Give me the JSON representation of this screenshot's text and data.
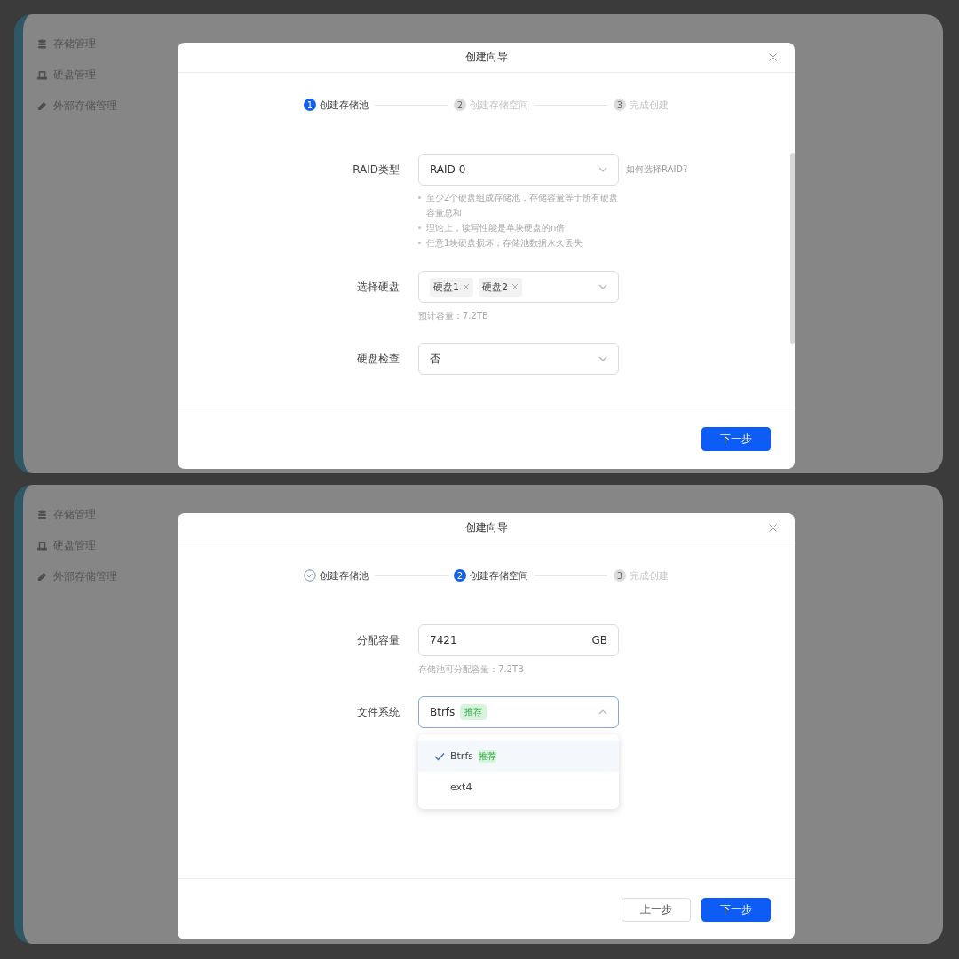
{
  "screens": [
    {
      "sidebar": {
        "items": [
          {
            "label": "存储管理"
          },
          {
            "label": "硬盘管理"
          },
          {
            "label": "外部存储管理"
          }
        ]
      },
      "dialog": {
        "title": "创建向导",
        "has_scrollbar": true,
        "steps": [
          {
            "kind": "current",
            "number": "1",
            "label": "创建存储池"
          },
          {
            "kind": "pending",
            "number": "2",
            "label": "创建存储空间"
          },
          {
            "kind": "pending",
            "number": "3",
            "label": "完成创建"
          }
        ],
        "fields": [
          {
            "kind": "select",
            "label": "RAID类型",
            "value": "RAID 0",
            "expanded": false,
            "link": "如何选择RAID?",
            "notes": [
              "至少2个硬盘组成存储池，存储容量等于所有硬盘容量总和",
              "理论上，读写性能是单块硬盘的n倍",
              "任意1块硬盘损坏，存储池数据永久丢失"
            ]
          },
          {
            "kind": "tags",
            "label": "选择硬盘",
            "tags": [
              "硬盘1",
              "硬盘2"
            ],
            "hint": "预计容量：7.2TB"
          },
          {
            "kind": "select",
            "label": "硬盘检查",
            "value": "否",
            "expanded": false
          }
        ],
        "buttons": [
          {
            "kind": "primary",
            "label": "下一步"
          }
        ]
      }
    },
    {
      "sidebar": {
        "items": [
          {
            "label": "存储管理"
          },
          {
            "label": "硬盘管理"
          },
          {
            "label": "外部存储管理"
          }
        ]
      },
      "dialog": {
        "title": "创建向导",
        "steps": [
          {
            "kind": "done",
            "label": "创建存储池"
          },
          {
            "kind": "current",
            "number": "2",
            "label": "创建存储空间"
          },
          {
            "kind": "pending",
            "number": "3",
            "label": "完成创建"
          }
        ],
        "fields": [
          {
            "kind": "input",
            "label": "分配容量",
            "value": "7421",
            "suffix": "GB",
            "hint": "存储池可分配容量：7.2TB"
          },
          {
            "kind": "select",
            "label": "文件系统",
            "value": "Btrfs",
            "badge": "推荐",
            "expanded": true,
            "options": [
              {
                "label": "Btrfs",
                "badge": "推荐",
                "selected": true
              },
              {
                "label": "ext4",
                "selected": false
              }
            ]
          }
        ],
        "buttons": [
          {
            "kind": "default",
            "label": "上一步"
          },
          {
            "kind": "primary",
            "label": "下一步"
          }
        ]
      }
    }
  ]
}
